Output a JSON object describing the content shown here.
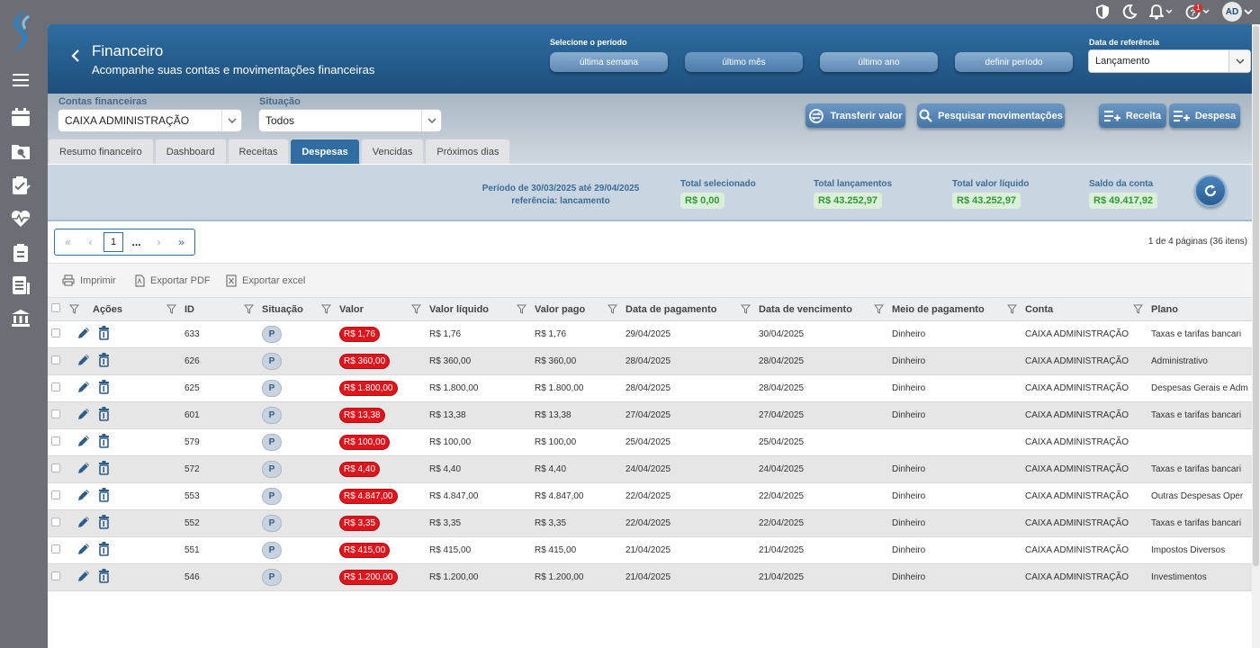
{
  "topbar": {
    "avatar": "AD",
    "notif_count": "1"
  },
  "header": {
    "title": "Financeiro",
    "subtitle": "Acompanhe suas contas e movimentações financeiras",
    "period_label": "Selecione o período",
    "period_buttons": [
      "última semana",
      "último mês",
      "último ano",
      "definir período"
    ],
    "ref_label": "Data de referência",
    "ref_value": "Lançamento"
  },
  "filters": {
    "contas_label": "Contas financeiras",
    "contas_value": "CAIXA ADMINISTRAÇÃO",
    "situacao_label": "Situação",
    "situacao_value": "Todos"
  },
  "actions": {
    "transferir": "Transferir valor",
    "pesquisar": "Pesquisar movimentações",
    "receita": "Receita",
    "despesa": "Despesa"
  },
  "tabs": [
    "Resumo financeiro",
    "Dashboard",
    "Receitas",
    "Despesas",
    "Vencidas",
    "Próximos dias"
  ],
  "summary": {
    "periodo_line1": "Período de 30/03/2025 até 29/04/2025",
    "periodo_line2": "referência: lancamento",
    "total_selecionado_label": "Total selecionado",
    "total_selecionado": "R$ 0,00",
    "total_lancamentos_label": "Total lançamentos",
    "total_lancamentos": "R$ 43.252,97",
    "total_liquido_label": "Total valor líquido",
    "total_liquido": "R$ 43.252,97",
    "saldo_label": "Saldo da conta",
    "saldo": "R$ 49.417,92"
  },
  "pager": {
    "first": "«",
    "prev": "‹",
    "current": "1",
    "dots": "...",
    "next": "›",
    "last": "»",
    "info": "1 de 4 páginas (36 itens)"
  },
  "toolbar": {
    "imprimir": "Imprimir",
    "exportar_pdf": "Exportar PDF",
    "exportar_excel": "Exportar excel"
  },
  "table": {
    "headers": {
      "acoes": "Ações",
      "id": "ID",
      "situacao": "Situação",
      "valor": "Valor",
      "valor_liquido": "Valor líquido",
      "valor_pago": "Valor pago",
      "data_pagamento": "Data de pagamento",
      "data_vencimento": "Data de vencimento",
      "meio_pagamento": "Meio de pagamento",
      "conta": "Conta",
      "plano": "Plano"
    },
    "rows": [
      {
        "id": "633",
        "sit": "P",
        "valor": "R$ 1,76",
        "liquido": "R$ 1,76",
        "pago": "R$ 1,76",
        "dpag": "29/04/2025",
        "dvenc": "30/04/2025",
        "meio": "Dinheiro",
        "conta": "CAIXA ADMINISTRAÇÃO",
        "plano": "Taxas e tarifas bancari"
      },
      {
        "id": "626",
        "sit": "P",
        "valor": "R$ 360,00",
        "liquido": "R$ 360,00",
        "pago": "R$ 360,00",
        "dpag": "28/04/2025",
        "dvenc": "28/04/2025",
        "meio": "Dinheiro",
        "conta": "CAIXA ADMINISTRAÇÃO",
        "plano": "Administrativo"
      },
      {
        "id": "625",
        "sit": "P",
        "valor": "R$ 1.800,00",
        "liquido": "R$ 1.800,00",
        "pago": "R$ 1.800,00",
        "dpag": "28/04/2025",
        "dvenc": "28/04/2025",
        "meio": "Dinheiro",
        "conta": "CAIXA ADMINISTRAÇÃO",
        "plano": "Despesas Gerais e Adm"
      },
      {
        "id": "601",
        "sit": "P",
        "valor": "R$ 13,38",
        "liquido": "R$ 13,38",
        "pago": "R$ 13,38",
        "dpag": "27/04/2025",
        "dvenc": "27/04/2025",
        "meio": "Dinheiro",
        "conta": "CAIXA ADMINISTRAÇÃO",
        "plano": "Taxas e tarifas bancari"
      },
      {
        "id": "579",
        "sit": "P",
        "valor": "R$ 100,00",
        "liquido": "R$ 100,00",
        "pago": "R$ 100,00",
        "dpag": "25/04/2025",
        "dvenc": "25/04/2025",
        "meio": "",
        "conta": "CAIXA ADMINISTRAÇÃO",
        "plano": ""
      },
      {
        "id": "572",
        "sit": "P",
        "valor": "R$ 4,40",
        "liquido": "R$ 4,40",
        "pago": "R$ 4,40",
        "dpag": "24/04/2025",
        "dvenc": "24/04/2025",
        "meio": "Dinheiro",
        "conta": "CAIXA ADMINISTRAÇÃO",
        "plano": "Taxas e tarifas bancari"
      },
      {
        "id": "553",
        "sit": "P",
        "valor": "R$ 4.847,00",
        "liquido": "R$ 4.847,00",
        "pago": "R$ 4.847,00",
        "dpag": "22/04/2025",
        "dvenc": "22/04/2025",
        "meio": "Dinheiro",
        "conta": "CAIXA ADMINISTRAÇÃO",
        "plano": "Outras Despesas Oper"
      },
      {
        "id": "552",
        "sit": "P",
        "valor": "R$ 3,35",
        "liquido": "R$ 3,35",
        "pago": "R$ 3,35",
        "dpag": "22/04/2025",
        "dvenc": "22/04/2025",
        "meio": "Dinheiro",
        "conta": "CAIXA ADMINISTRAÇÃO",
        "plano": "Taxas e tarifas bancari"
      },
      {
        "id": "551",
        "sit": "P",
        "valor": "R$ 415,00",
        "liquido": "R$ 415,00",
        "pago": "R$ 415,00",
        "dpag": "21/04/2025",
        "dvenc": "21/04/2025",
        "meio": "Dinheiro",
        "conta": "CAIXA ADMINISTRAÇÃO",
        "plano": "Impostos Diversos"
      },
      {
        "id": "546",
        "sit": "P",
        "valor": "R$ 1.200,00",
        "liquido": "R$ 1.200,00",
        "pago": "R$ 1.200,00",
        "dpag": "21/04/2025",
        "dvenc": "21/04/2025",
        "meio": "Dinheiro",
        "conta": "CAIXA ADMINISTRAÇÃO",
        "plano": "Investimentos"
      }
    ]
  }
}
